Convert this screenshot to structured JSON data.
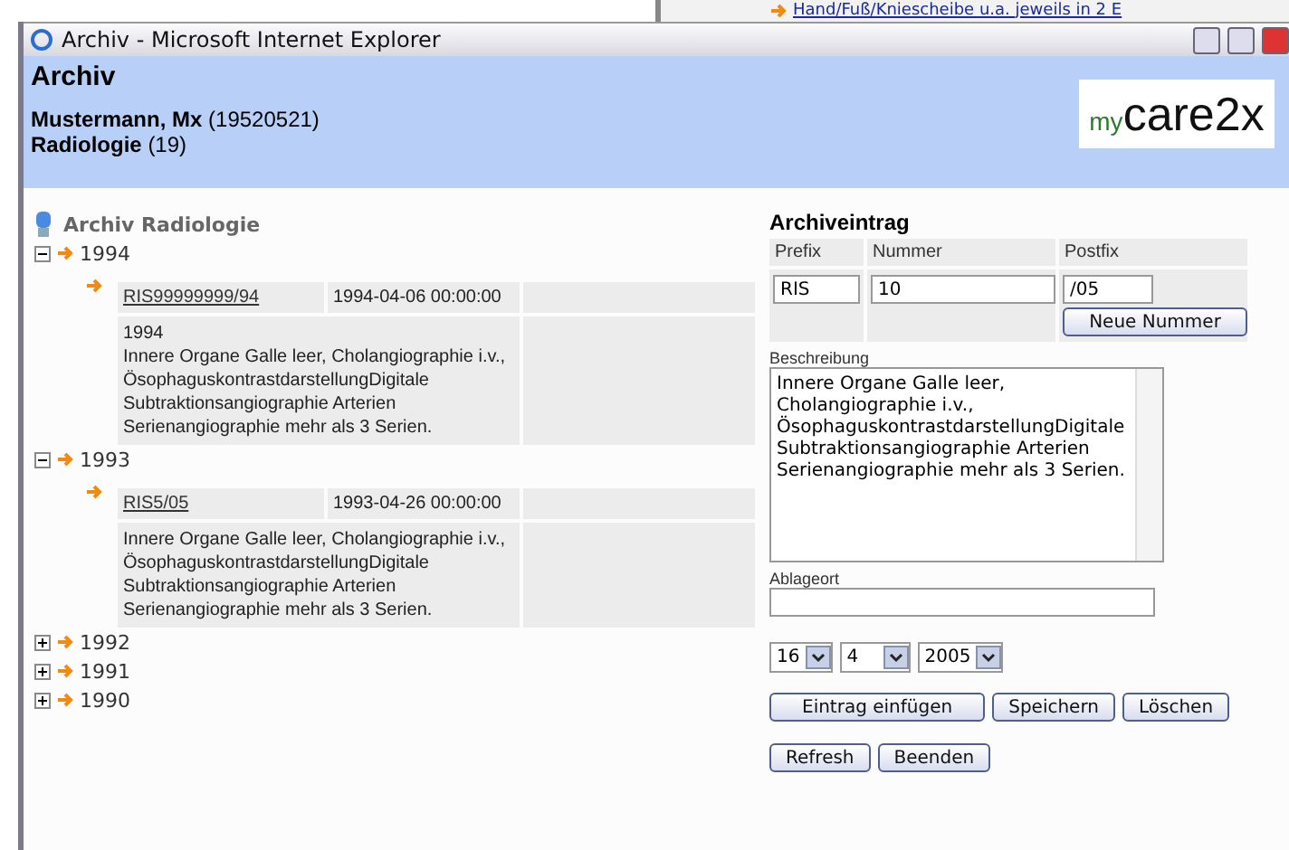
{
  "background_window": {
    "tree_text": "Hand/Fuß/Kniescheibe u.a. jeweils in 2 E"
  },
  "window": {
    "title": "Archiv - Microsoft Internet Explorer"
  },
  "header": {
    "title": "Archiv",
    "patient_name": "Mustermann, Mx",
    "patient_id": "(19520521)",
    "department": "Radiologie",
    "department_count": "(19)",
    "logo_prefix": "my",
    "logo_main": "care2x"
  },
  "archive_tree": {
    "title": "Archiv Radiologie",
    "years": [
      {
        "label": "1994",
        "expanded": true,
        "entries": [
          {
            "number": "RIS99999999/94",
            "date": "1994-04-06 00:00:00",
            "description_lines": [
              "1994",
              "Innere Organe Galle leer, Cholangiographie i.v.,",
              "ÖsophaguskontrastdarstellungDigitale",
              "Subtraktionsangiographie Arterien",
              "Serienangiographie mehr als 3 Serien."
            ]
          }
        ]
      },
      {
        "label": "1993",
        "expanded": true,
        "entries": [
          {
            "number": "RIS5/05",
            "date": "1993-04-26 00:00:00",
            "description_lines": [
              "Innere Organe Galle leer, Cholangiographie i.v.,",
              "ÖsophaguskontrastdarstellungDigitale",
              "Subtraktionsangiographie Arterien",
              "Serienangiographie mehr als 3 Serien."
            ]
          }
        ]
      },
      {
        "label": "1992",
        "expanded": false
      },
      {
        "label": "1991",
        "expanded": false
      },
      {
        "label": "1990",
        "expanded": false
      }
    ]
  },
  "entry_form": {
    "title": "Archiveintrag",
    "prefix_label": "Prefix",
    "number_label": "Nummer",
    "postfix_label": "Postfix",
    "prefix": "RIS",
    "number": "10",
    "postfix": "/05",
    "new_number_button": "Neue Nummer",
    "description_label": "Beschreibung",
    "description": "Innere Organe Galle leer,\nCholangiographie i.v.,\nÖsophaguskontrastdarstellungDigitale\nSubtraktionsangiographie Arterien\nSerienangiographie mehr als 3 Serien.",
    "location_label": "Ablageort",
    "day": "16",
    "month": "4",
    "year": "2005",
    "action_buttons": [
      "Eintrag einfügen",
      "Speichern",
      "Löschen"
    ],
    "bottom_buttons": [
      "Refresh",
      "Beenden"
    ]
  }
}
